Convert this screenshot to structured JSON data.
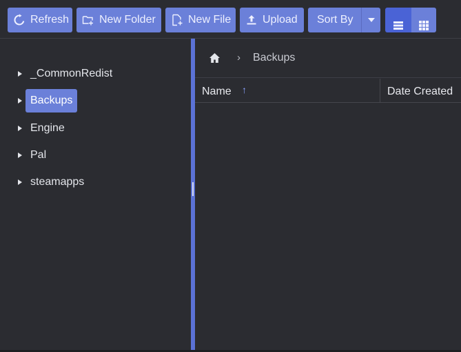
{
  "toolbar": {
    "refresh_label": "Refresh",
    "new_folder_label": "New Folder",
    "new_file_label": "New File",
    "upload_label": "Upload",
    "sort_by_label": "Sort By"
  },
  "tree": {
    "items": [
      {
        "label": "_CommonRedist",
        "selected": false
      },
      {
        "label": "Backups",
        "selected": true
      },
      {
        "label": "Engine",
        "selected": false
      },
      {
        "label": "Pal",
        "selected": false
      },
      {
        "label": "steamapps",
        "selected": false
      }
    ]
  },
  "breadcrumb": {
    "current": "Backups"
  },
  "table": {
    "columns": [
      "Name",
      "Date Created"
    ],
    "sort_column": "Name",
    "sort_direction": "ascending",
    "rows": []
  },
  "colors": {
    "accent": "#6b80d9",
    "accent_active": "#4a63d6",
    "panel": "#2b2c31"
  }
}
